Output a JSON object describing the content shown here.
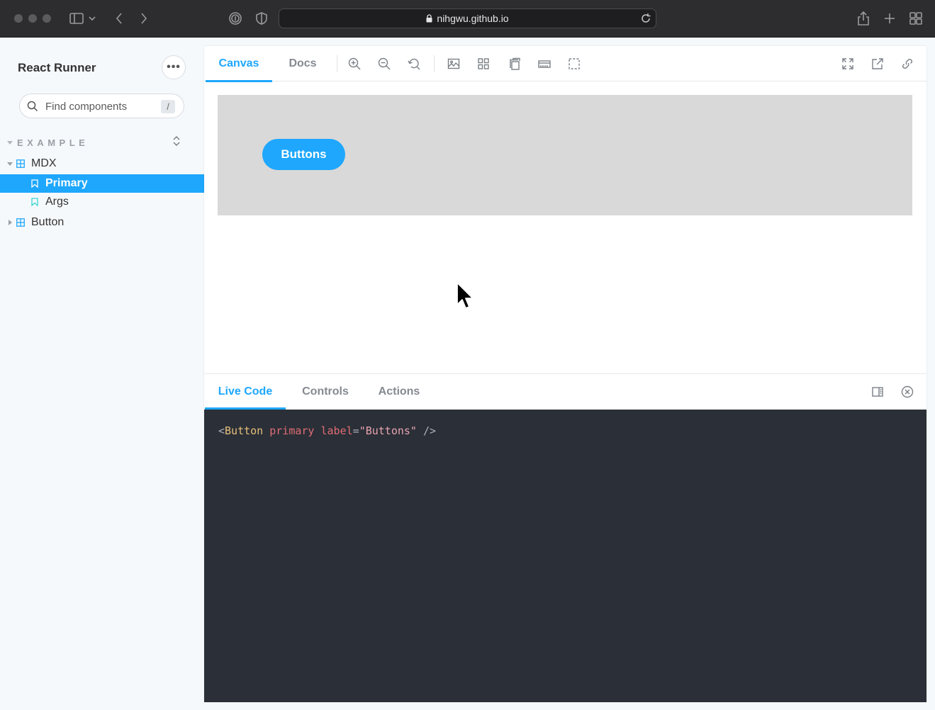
{
  "browser": {
    "url": "nihgwu.github.io"
  },
  "sidebar": {
    "title": "React Runner",
    "menu_label": "•••",
    "search": {
      "placeholder": "Find components",
      "shortcut": "/"
    },
    "group": "EXAMPLE",
    "tree": [
      {
        "label": "MDX",
        "type": "component",
        "expanded": true
      },
      {
        "label": "Primary",
        "type": "story",
        "selected": true
      },
      {
        "label": "Args",
        "type": "story",
        "selected": false
      },
      {
        "label": "Button",
        "type": "component",
        "expanded": false
      }
    ]
  },
  "toolbar": {
    "tabs": [
      {
        "label": "Canvas",
        "active": true
      },
      {
        "label": "Docs",
        "active": false
      }
    ],
    "tools": [
      "zoom-in-icon",
      "zoom-out-icon",
      "reset-zoom-icon",
      "background-icon",
      "grid-icon",
      "viewport-icon",
      "measure-icon",
      "outline-icon"
    ],
    "right_tools": [
      "fullscreen-icon",
      "open-new-tab-icon",
      "copy-link-icon"
    ]
  },
  "canvas": {
    "button_label": "Buttons",
    "button_color": "#1ea7fd",
    "background": "#d9d9d9"
  },
  "addons": {
    "tabs": [
      {
        "label": "Live Code",
        "active": true
      },
      {
        "label": "Controls",
        "active": false
      },
      {
        "label": "Actions",
        "active": false
      }
    ],
    "code": {
      "open": "<",
      "tag": "Button",
      "attr_primary": "primary",
      "attr_label": "label",
      "eq": "=",
      "value": "\"Buttons\"",
      "close": "/>"
    }
  },
  "colors": {
    "accent": "#1ea7fd",
    "code_bg": "#2b2f37",
    "sidebar_bg": "#f6f9fc"
  }
}
